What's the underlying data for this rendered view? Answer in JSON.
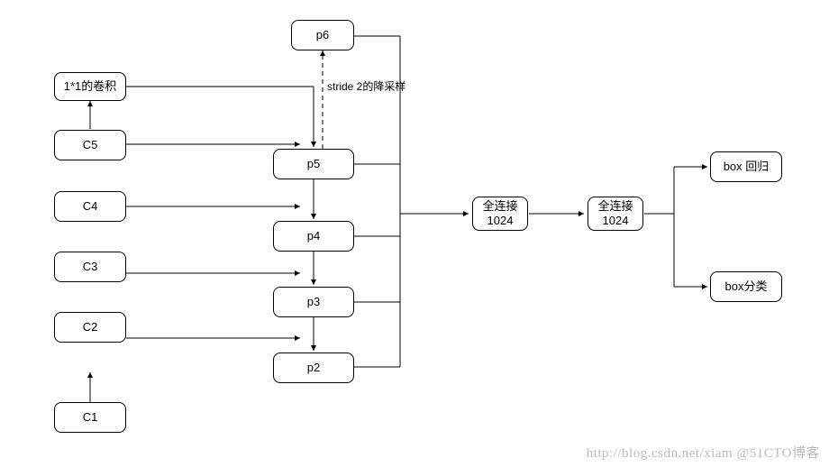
{
  "nodes": {
    "conv11": "1*1的卷积",
    "c5": "C5",
    "c4": "C4",
    "c3": "C3",
    "c2": "C2",
    "c1": "C1",
    "p6": "p6",
    "p5": "p5",
    "p4": "p4",
    "p3": "p3",
    "p2": "p2",
    "fc1": "全连接\n1024",
    "fc2": "全连接\n1024",
    "box_reg": "box 回归",
    "box_cls": "box分类"
  },
  "labels": {
    "stride2": "stride 2的降采样"
  },
  "watermark": "http://blog.csdn.net/xiam   @51CTO博客"
}
